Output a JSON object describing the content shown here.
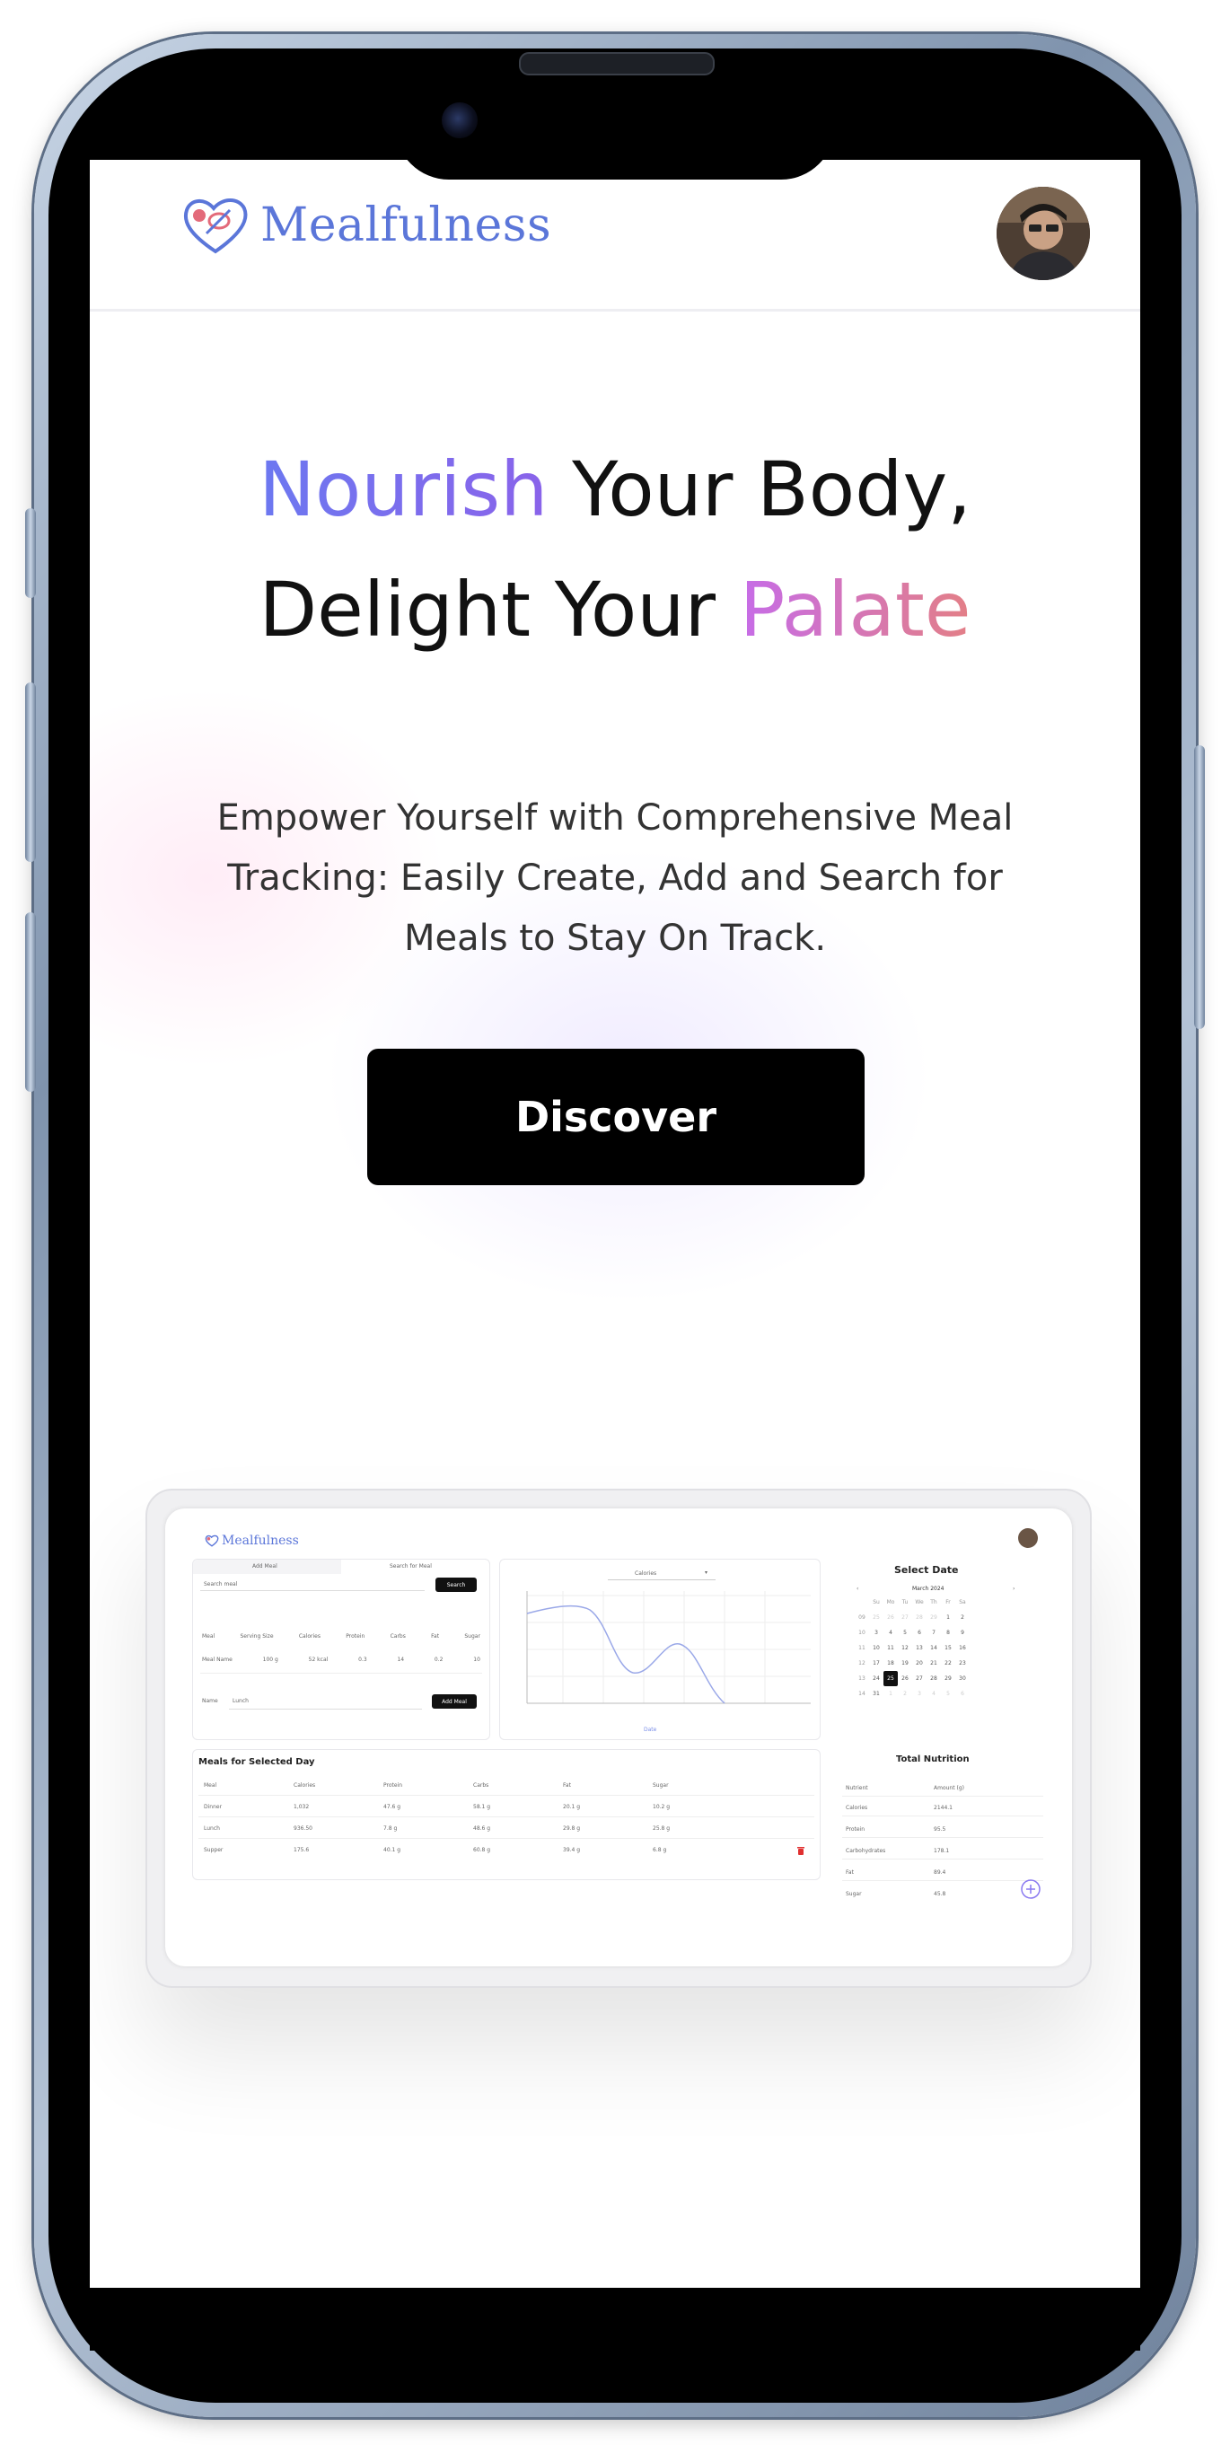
{
  "site": {
    "brand": "Mealfulness",
    "colors": {
      "brand": "#5b76d9",
      "accent_purple": "#7a6ff0",
      "accent_pink": "#e37f86",
      "cta": "#000000"
    }
  },
  "hero": {
    "title_line1_accent": "Nourish",
    "title_line1_rest": " Your Body,",
    "title_line2_lead": "Delight Your ",
    "title_line2_accent": "Palate",
    "subtitle": "Empower Yourself with Comprehensive Meal Tracking: Easily Create, Add and Search for Meals to Stay On Track.",
    "cta_label": "Discover"
  },
  "preview": {
    "brand": "Mealfulness",
    "tabs": [
      "Add Meal",
      "Search for Meal"
    ],
    "search_placeholder": "Search meal",
    "search_button": "Search",
    "table_headers": [
      "Meal",
      "Serving Size",
      "Calories",
      "Protein",
      "Carbs",
      "Fat",
      "Sugar"
    ],
    "table_row": [
      "Meal Name",
      "100 g",
      "52 kcal",
      "0.3",
      "14",
      "0.2",
      "10"
    ],
    "name_label": "Name",
    "name_value": "Lunch",
    "add_button": "Add Meal",
    "chart_selector": "Calories",
    "chart_x_label": "Date",
    "select_date_title": "Select Date",
    "calendar_month": "March 2024",
    "calendar_weekdays": [
      "",
      "Su",
      "Mo",
      "Tu",
      "We",
      "Th",
      "Fr",
      "Sa"
    ],
    "calendar_rows": [
      [
        "09",
        "25",
        "26",
        "27",
        "28",
        "29",
        "1",
        "2"
      ],
      [
        "10",
        "3",
        "4",
        "5",
        "6",
        "7",
        "8",
        "9"
      ],
      [
        "11",
        "10",
        "11",
        "12",
        "13",
        "14",
        "15",
        "16"
      ],
      [
        "12",
        "17",
        "18",
        "19",
        "20",
        "21",
        "22",
        "23"
      ],
      [
        "13",
        "24",
        "25",
        "26",
        "27",
        "28",
        "29",
        "30"
      ],
      [
        "14",
        "31",
        "1",
        "2",
        "3",
        "4",
        "5",
        "6"
      ]
    ],
    "meals_title": "Meals for Selected Day",
    "meals_headers": [
      "Meal",
      "Calories",
      "Protein",
      "Carbs",
      "Fat",
      "Sugar"
    ],
    "meals_rows": [
      [
        "Dinner",
        "1,032",
        "47.6 g",
        "58.1 g",
        "20.1 g",
        "10.2 g"
      ],
      [
        "Lunch",
        "936.50",
        "7.8 g",
        "48.6 g",
        "29.8 g",
        "25.8 g"
      ],
      [
        "Supper",
        "175.6",
        "40.1 g",
        "60.8 g",
        "39.4 g",
        "6.8 g"
      ]
    ],
    "total_title": "Total Nutrition",
    "total_headers": [
      "Nutrient",
      "Amount (g)"
    ],
    "total_rows": [
      [
        "Calories",
        "2144.1"
      ],
      [
        "Protein",
        "95.5"
      ],
      [
        "Carbohydrates",
        "178.1"
      ],
      [
        "Fat",
        "89.4"
      ],
      [
        "Sugar",
        "45.8"
      ]
    ]
  }
}
